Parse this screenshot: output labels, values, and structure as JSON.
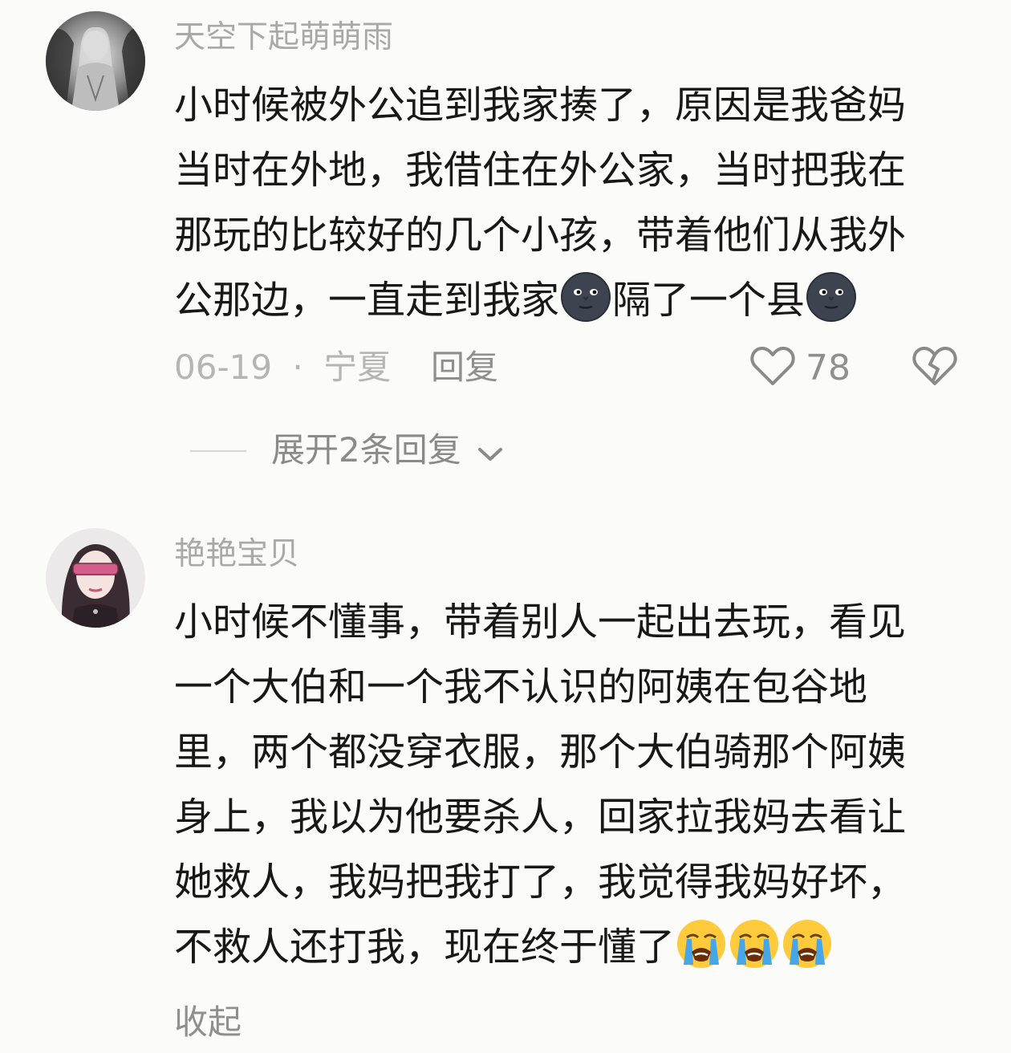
{
  "comments": [
    {
      "username": "天空下起萌萌雨",
      "lines": [
        [
          "小时候被外公追到我家揍了，原因是我爸妈"
        ],
        [
          "当时在外地，我借住在外公家，当时把我在"
        ],
        [
          "那玩的比较好的几个小孩，带着他们从我外"
        ],
        [
          "公那边，一直走到我家",
          "隔了一个县"
        ]
      ],
      "emoji": "new-moon-face",
      "date": "06-19",
      "separator": "·",
      "location": "宁夏",
      "reply_label": "回复",
      "like_count": "78",
      "expand_label": "展开2条回复"
    },
    {
      "username": "艳艳宝贝",
      "lines": [
        "小时候不懂事，带着别人一起出去玩，看见",
        "一个大伯和一个我不认识的阿姨在包谷地",
        "里，两个都没穿衣服，那个大伯骑那个阿姨",
        "身上，我以为他要杀人，回家拉我妈去看让",
        "她救人，我妈把我打了，我觉得我妈好坏，",
        "不救人还打我，现在终于懂了"
      ],
      "emoji": "loudly-crying-face",
      "collapse_label": "收起"
    }
  ],
  "colors": {
    "background": "#fbfbf9",
    "text": "#181818",
    "username": "#a9a9a9",
    "meta": "#b5b5b5"
  }
}
